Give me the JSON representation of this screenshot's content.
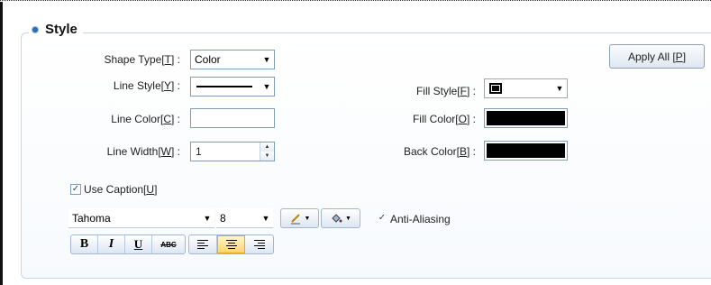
{
  "section": {
    "title": "Style"
  },
  "apply_all": {
    "text": "Apply All ",
    "key": "P"
  },
  "shape_type": {
    "label": "Shape Type",
    "key": "T",
    "value": "Color"
  },
  "line_style": {
    "label": "Line Style",
    "key": "Y"
  },
  "line_color": {
    "label": "Line Color",
    "key": "C",
    "color": "#ffffff"
  },
  "line_width": {
    "label": "Line Width",
    "key": "W",
    "value": "1"
  },
  "fill_style": {
    "label": "Fill Style",
    "key": "F"
  },
  "fill_color": {
    "label": "Fill Color",
    "key": "O",
    "color": "#000000"
  },
  "back_color": {
    "label": "Back Color",
    "key": "B",
    "color": "#000000"
  },
  "use_caption": {
    "label": "Use Caption",
    "key": "U",
    "checked": true
  },
  "font": {
    "family": "Tahoma",
    "size": "8"
  },
  "anti_aliasing": {
    "label": "Anti-Aliasing",
    "checked": true
  },
  "format_buttons": {
    "bold": "B",
    "italic": "I",
    "underline": "U",
    "strike": "ABC"
  },
  "icons": {
    "pen_color": "pencil-color-icon",
    "fill_bucket": "paint-bucket-icon",
    "align_left": "align-left-icon",
    "align_center": "align-center-icon",
    "align_right": "align-right-icon"
  },
  "colors": {
    "accent": "#2b6cb3",
    "border": "#7f9db9",
    "active": "#ffd56a"
  }
}
